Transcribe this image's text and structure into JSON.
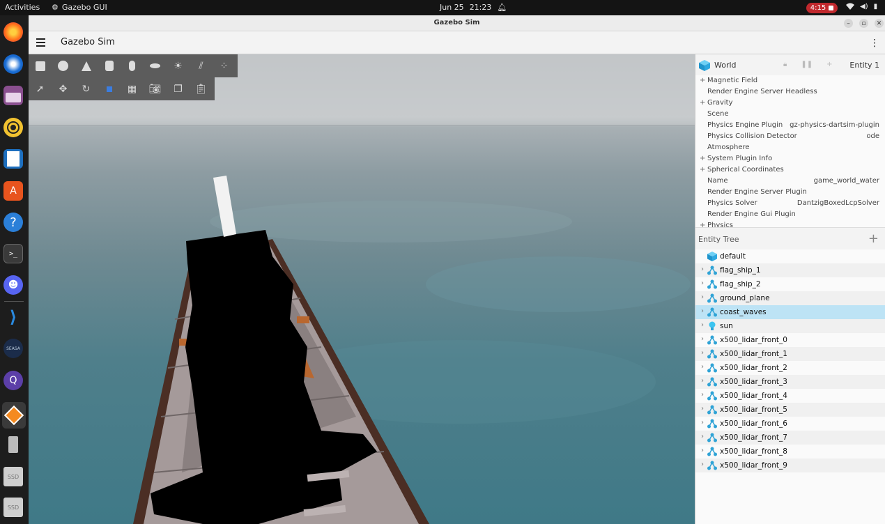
{
  "topbar": {
    "activities": "Activities",
    "app_name": "Gazebo GUI",
    "date": "Jun 25",
    "time": "21:23",
    "recording_time": "4:15"
  },
  "window": {
    "title": "Gazebo Sim",
    "app_title": "Gazebo Sim"
  },
  "dock": {
    "items": [
      "firefox-icon",
      "thunderbird-icon",
      "files-icon",
      "rhythmbox-icon",
      "writer-icon",
      "app-center-icon",
      "help-icon",
      "terminal-icon",
      "discord-icon",
      "vscode-icon",
      "seasa-icon",
      "qgroundcontrol-icon",
      "gazebo-icon",
      "usb-drive-icon",
      "ssd-icon",
      "ssd-icon"
    ],
    "ssd_label": "SSD"
  },
  "world": {
    "name": "World",
    "entity_label": "Entity 1",
    "properties": [
      {
        "expand": "+",
        "label": "Magnetic Field",
        "value": ""
      },
      {
        "expand": "",
        "label": "Render Engine Server Headless",
        "value": ""
      },
      {
        "expand": "+",
        "label": "Gravity",
        "value": ""
      },
      {
        "expand": "",
        "label": "Scene",
        "value": ""
      },
      {
        "expand": "",
        "label": "Physics Engine Plugin",
        "value": "gz-physics-dartsim-plugin"
      },
      {
        "expand": "",
        "label": "Physics Collision Detector",
        "value": "ode"
      },
      {
        "expand": "",
        "label": "Atmosphere",
        "value": ""
      },
      {
        "expand": "+",
        "label": "System Plugin Info",
        "value": ""
      },
      {
        "expand": "+",
        "label": "Spherical Coordinates",
        "value": ""
      },
      {
        "expand": "",
        "label": "Name",
        "value": "game_world_water"
      },
      {
        "expand": "",
        "label": "Render Engine Server Plugin",
        "value": ""
      },
      {
        "expand": "",
        "label": "Physics Solver",
        "value": "DantzigBoxedLcpSolver"
      },
      {
        "expand": "",
        "label": "Render Engine Gui Plugin",
        "value": ""
      },
      {
        "expand": "+",
        "label": "Physics",
        "value": ""
      }
    ]
  },
  "entity_tree": {
    "title": "Entity Tree",
    "add": "+",
    "items": [
      {
        "name": "default",
        "kind": "world",
        "expandable": false
      },
      {
        "name": "flag_ship_1",
        "kind": "model",
        "expandable": true
      },
      {
        "name": "flag_ship_2",
        "kind": "model",
        "expandable": true
      },
      {
        "name": "ground_plane",
        "kind": "model",
        "expandable": true
      },
      {
        "name": "coast_waves",
        "kind": "model",
        "expandable": true,
        "selected": true
      },
      {
        "name": "sun",
        "kind": "light",
        "expandable": true
      },
      {
        "name": "x500_lidar_front_0",
        "kind": "model",
        "expandable": true
      },
      {
        "name": "x500_lidar_front_1",
        "kind": "model",
        "expandable": true
      },
      {
        "name": "x500_lidar_front_2",
        "kind": "model",
        "expandable": true
      },
      {
        "name": "x500_lidar_front_3",
        "kind": "model",
        "expandable": true
      },
      {
        "name": "x500_lidar_front_4",
        "kind": "model",
        "expandable": true
      },
      {
        "name": "x500_lidar_front_5",
        "kind": "model",
        "expandable": true
      },
      {
        "name": "x500_lidar_front_6",
        "kind": "model",
        "expandable": true
      },
      {
        "name": "x500_lidar_front_7",
        "kind": "model",
        "expandable": true
      },
      {
        "name": "x500_lidar_front_8",
        "kind": "model",
        "expandable": true
      },
      {
        "name": "x500_lidar_front_9",
        "kind": "model",
        "expandable": true
      }
    ]
  },
  "toolbar": {
    "shapes": [
      "box-icon",
      "sphere-icon",
      "cone-icon",
      "cylinder-icon",
      "capsule-icon",
      "ellipsoid-icon",
      "sun-light-icon",
      "directional-light-icon",
      "spot-light-icon"
    ],
    "tools": [
      "select-icon",
      "translate-icon",
      "rotate-icon",
      "transform-icon",
      "grid-icon",
      "screenshot-icon",
      "copy-icon",
      "paste-icon"
    ]
  },
  "colors": {
    "accent_selected": "#bde3f5",
    "model_icon": "#2fa3d6",
    "recording": "#c0282d"
  }
}
